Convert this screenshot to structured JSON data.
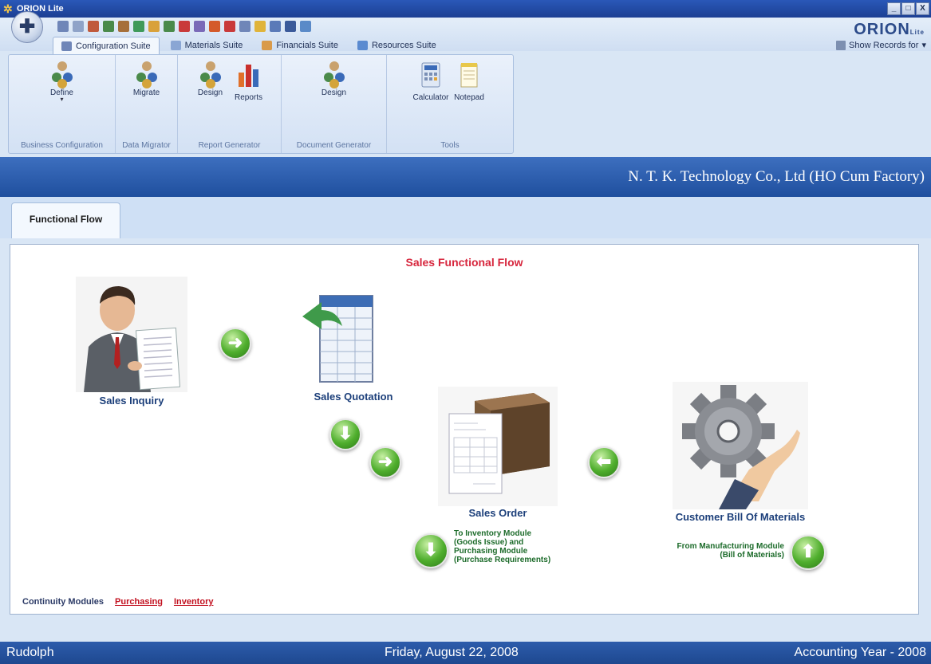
{
  "window": {
    "title": "ORION Lite",
    "minimize": "_",
    "maximize": "□",
    "close": "X"
  },
  "brand": {
    "name": "ORION",
    "suffix": "Lite"
  },
  "ribbon": {
    "tabs": [
      {
        "label": "Configuration Suite",
        "active": true
      },
      {
        "label": "Materials Suite"
      },
      {
        "label": "Financials Suite"
      },
      {
        "label": "Resources Suite"
      }
    ],
    "show_records": "Show Records for",
    "groups": [
      {
        "label": "Business Configuration",
        "buttons": [
          "Define"
        ]
      },
      {
        "label": "Data Migrator",
        "buttons": [
          "Migrate"
        ]
      },
      {
        "label": "Report Generator",
        "buttons": [
          "Design",
          "Reports"
        ]
      },
      {
        "label": "Document Generator",
        "buttons": [
          "Design"
        ]
      },
      {
        "label": "Tools",
        "buttons": [
          "Calculator",
          "Notepad"
        ]
      }
    ]
  },
  "company": "N. T. K. Technology Co., Ltd (HO Cum Factory)",
  "content_tab": "Functional Flow",
  "flow": {
    "title": "Sales Functional Flow",
    "nodes": {
      "inquiry": "Sales Inquiry",
      "quotation": "Sales Quotation",
      "order": "Sales Order",
      "bom": "Customer Bill Of Materials"
    },
    "notes": {
      "to_inventory": [
        "To Inventory Module",
        "(Goods Issue) and",
        "Purchasing Module",
        "(Purchase Requirements)"
      ],
      "from_manufacturing": [
        "From Manufacturing Module",
        "(Bill of Materials)"
      ]
    }
  },
  "continuity": {
    "label": "Continuity Modules",
    "links": [
      "Purchasing",
      "Inventory"
    ]
  },
  "status": {
    "user": "Rudolph",
    "date": "Friday, August 22, 2008",
    "year": "Accounting Year - 2008"
  },
  "colors": {
    "accent_red": "#d7263d",
    "banner_blue": "#2c5daa",
    "arrow_green": "#4fae2d"
  }
}
